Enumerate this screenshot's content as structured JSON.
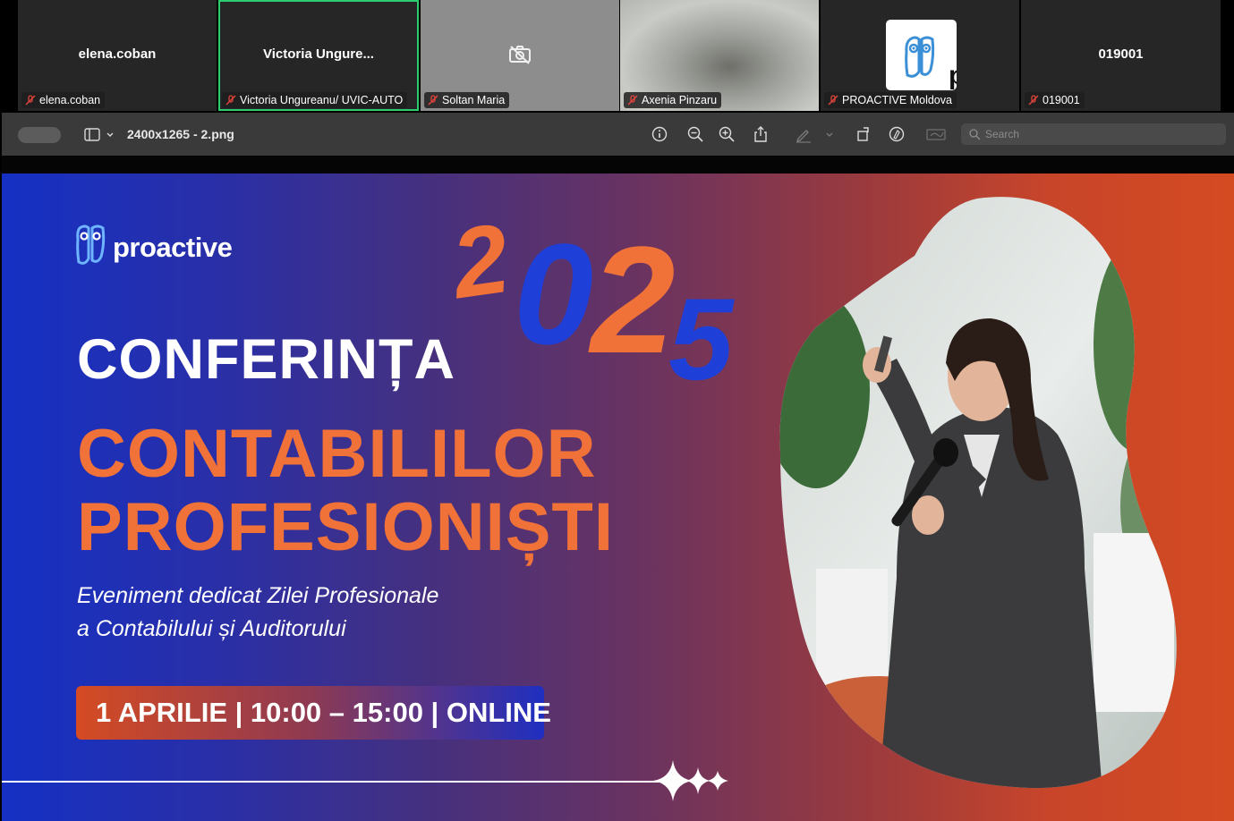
{
  "participants": [
    {
      "display_name": "elena.coban",
      "tag": "elena.coban",
      "muted": true
    },
    {
      "display_name": "Victoria  Ungure...",
      "tag": "Victoria Ungureanu/ UVIC-AUTO",
      "muted": true,
      "active_speaker": true
    },
    {
      "display_name": "",
      "tag": "Soltan Maria",
      "muted": true,
      "video": "camera-off"
    },
    {
      "display_name": "",
      "tag": "Axenia Pinzaru",
      "muted": true,
      "video": "blurred"
    },
    {
      "display_name": "",
      "tag": "PROACTIVE Moldova",
      "muted": true,
      "video": "logo"
    },
    {
      "display_name": "019001",
      "tag": "019001",
      "muted": true
    }
  ],
  "viewer": {
    "filename": "2400x1265 - 2.png",
    "search_placeholder": "Search",
    "icons": [
      "sidebar-icon",
      "info-icon",
      "zoom-out-icon",
      "zoom-in-icon",
      "share-icon",
      "markup-pen-icon",
      "rotate-icon",
      "annotate-icon",
      "sign-icon",
      "search-icon"
    ]
  },
  "banner": {
    "logo_text": "proactive",
    "year": "2025",
    "title_line1": "CONFERINȚA",
    "title_line2": "CONTABILILOR",
    "title_line3": "PROFESIONIȘTI",
    "subtitle_line1": "Eveniment dedicat Zilei Profesionale",
    "subtitle_line2": "a Contabilului și Auditorului",
    "event_info": "1 APRILIE | 10:00 – 15:00 | ONLINE",
    "colors": {
      "orange": "#f07238",
      "blue": "#1e3fd8",
      "white": "#ffffff"
    }
  }
}
